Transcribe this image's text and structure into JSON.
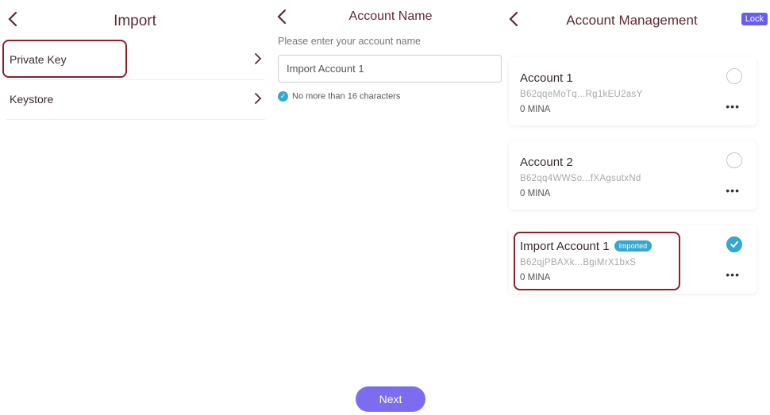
{
  "import_screen": {
    "title": "Import",
    "options": [
      {
        "label": "Private Key"
      },
      {
        "label": "Keystore"
      }
    ]
  },
  "account_name_screen": {
    "title": "Account Name",
    "hint": "Please enter your account name",
    "input_value": "Import Account 1",
    "rule": "No more than 16 characters",
    "next_label": "Next"
  },
  "account_management_screen": {
    "title": "Account Management",
    "lock_label": "Lock",
    "accounts": [
      {
        "name": "Account 1",
        "address": "B62qqeMoTq...Rg1kEU2asY",
        "balance": "0 MINA",
        "selected": false
      },
      {
        "name": "Account 2",
        "address": "B62qq4WWSo...fXAgsutxNd",
        "balance": "0 MINA",
        "selected": false
      },
      {
        "name": "Import Account 1",
        "badge": "Imported",
        "address": "B62qjPBAXk...BgiMrX1bxS",
        "balance": "0 MINA",
        "selected": true
      }
    ]
  },
  "colors": {
    "accent": "#7b6cf0",
    "highlight": "#8b1f2c",
    "check": "#35a8cf",
    "title": "#5e2a34"
  },
  "icons": {
    "back": "chevron-left-icon",
    "forward": "chevron-right-icon",
    "more": "more-dots-icon",
    "check": "check-icon"
  }
}
